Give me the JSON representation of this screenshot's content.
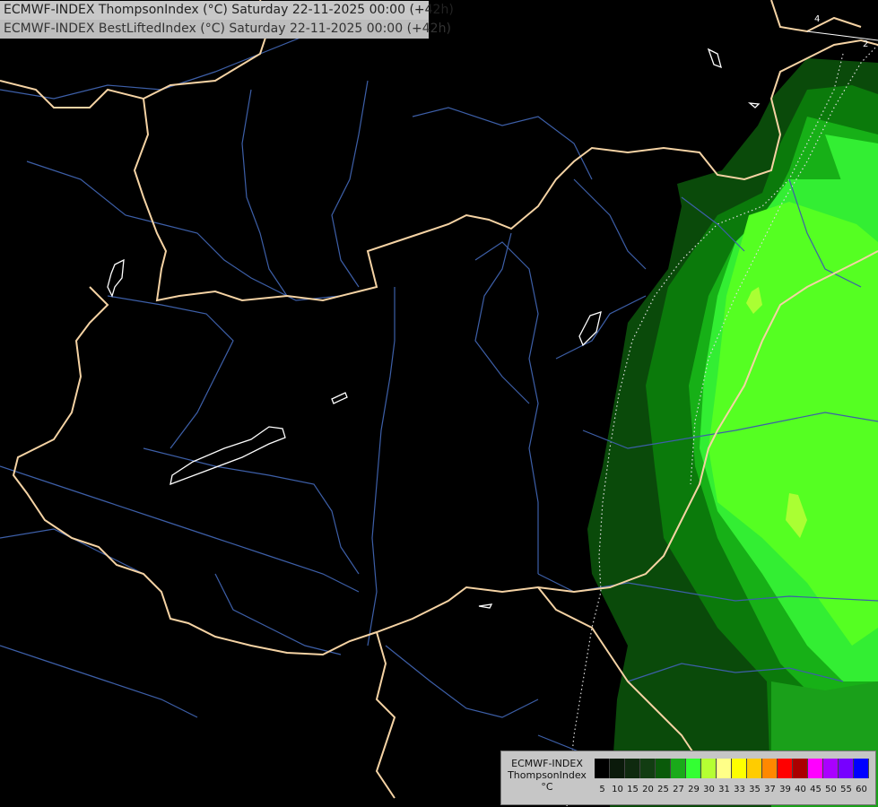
{
  "titles": {
    "line1": "ECMWF-INDEX ThompsonIndex (°C) Saturday 22-11-2025 00:00 (+42h)",
    "line2": "ECMWF-INDEX BestLiftedIndex (°C) Saturday 22-11-2025 00:00 (+42h)"
  },
  "contour_labels": [
    "4",
    "2"
  ],
  "legend": {
    "title_lines": [
      "ECMWF-INDEX",
      "ThompsonIndex",
      "°C"
    ],
    "ticks": [
      "5",
      "10",
      "15",
      "20",
      "25",
      "27",
      "29",
      "30",
      "31",
      "33",
      "35",
      "37",
      "39",
      "40",
      "45",
      "50",
      "55",
      "60"
    ],
    "colors": [
      "#000000",
      "#0b1a0b",
      "#0f2a0f",
      "#123d12",
      "#0a5a0a",
      "#1aaa1a",
      "#33ff33",
      "#b5ff33",
      "#ffff88",
      "#ffff00",
      "#ffcc00",
      "#ff8800",
      "#ff0000",
      "#aa0000",
      "#ff00ff",
      "#aa00ff",
      "#7700ff",
      "#0000ff"
    ]
  },
  "colors": {
    "background": "#000000",
    "border": "#f5d3a4",
    "river": "#3d5fa8",
    "lake": "#ffffff",
    "green_dark": "#0a4a0a",
    "green_mid": "#0b6e0b",
    "green_bright": "#22dd22",
    "green_light": "#44ff44",
    "green_yellow": "#aaff33"
  }
}
